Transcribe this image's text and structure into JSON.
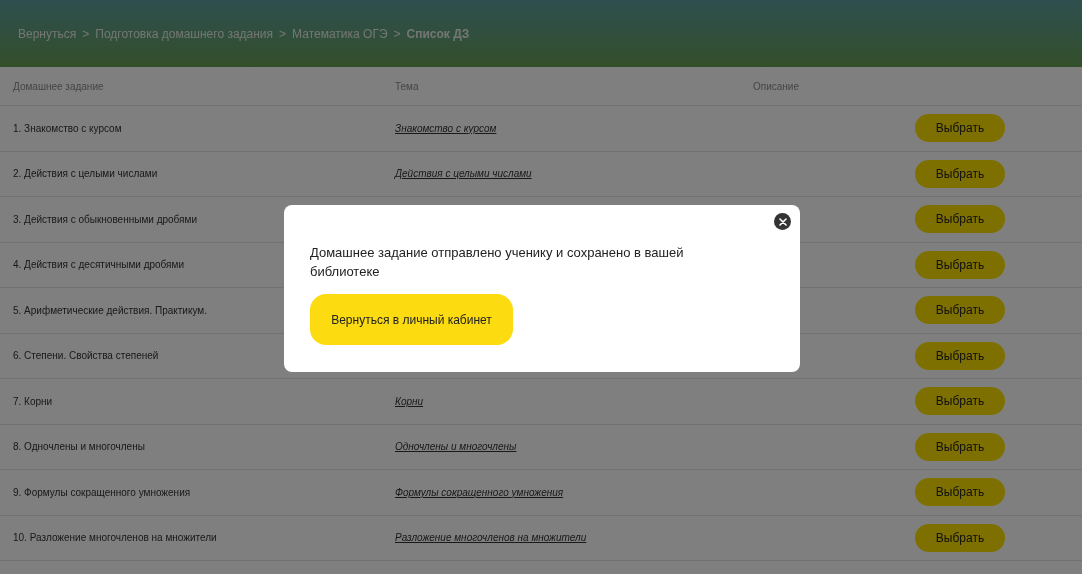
{
  "breadcrumbs": [
    {
      "label": "Вернуться",
      "current": false
    },
    {
      "label": "Подготовка домашнего задания",
      "current": false
    },
    {
      "label": "Математика ОГЭ",
      "current": false
    },
    {
      "label": "Список ДЗ",
      "current": true
    }
  ],
  "separator": ">",
  "table": {
    "columns": [
      "Домашнее задание",
      "Тема",
      "Описание"
    ],
    "rows": [
      {
        "title": "1. Знакомство с курсом",
        "topic": "Знакомство с курсом",
        "action": "Выбрать"
      },
      {
        "title": "2. Действия с целыми числами",
        "topic": "Действия с целыми числами",
        "action": "Выбрать"
      },
      {
        "title": "3. Действия с обыкновенными дробями",
        "action": "Выбрать"
      },
      {
        "title": "4. Действия с десятичными дробями",
        "action": "Выбрать"
      },
      {
        "title": "5. Арифметические действия. Практикум.",
        "action": "Выбрать"
      },
      {
        "title": "6. Степени. Свойства степеней",
        "action": "Выбрать"
      },
      {
        "title": "7. Корни",
        "topic": "Корни",
        "action": "Выбрать"
      },
      {
        "title": "8. Одночлены и многочлены",
        "topic": "Одночлены и многочлены",
        "action": "Выбрать"
      },
      {
        "title": "9. Формулы сокращенного умножения",
        "topic": "Формулы сокращенного умножения",
        "action": "Выбрать"
      },
      {
        "title": "10. Разложение многочленов на множители",
        "topic": "Разложение многочленов на множители",
        "action": "Выбрать"
      }
    ]
  },
  "dialog": {
    "open": true,
    "message": "Домашнее задание отправлено ученику и сохранено в вашей библиотеке",
    "button": "Вернуться в личный кабинет"
  }
}
